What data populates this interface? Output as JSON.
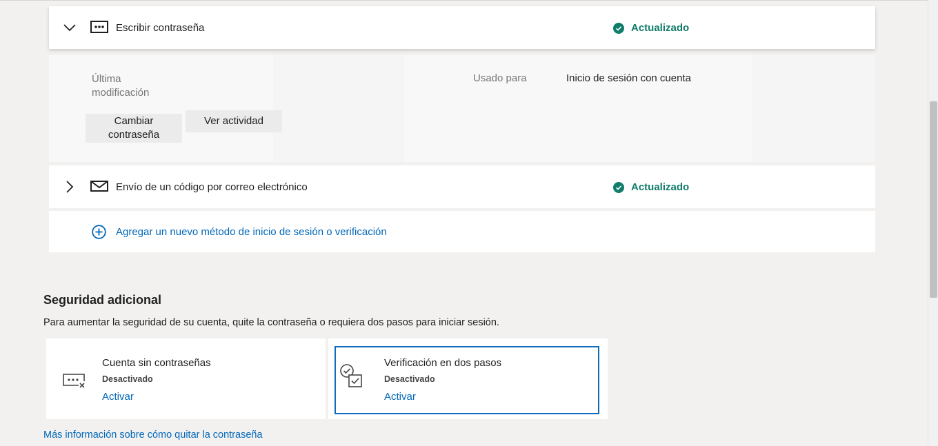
{
  "colors": {
    "accent_link": "#0067b8",
    "status_green": "#107c6a",
    "focus_border": "#0f6cbd",
    "background": "#f2f1f0"
  },
  "methods": [
    {
      "title": "Escribir contraseña",
      "status": "Actualizado",
      "expanded": true,
      "chevron_icon": "chevron-down-icon",
      "icon": "password-dots-icon"
    },
    {
      "title": "Envío de un código por correo electrónico",
      "status": "Actualizado",
      "expanded": false,
      "chevron_icon": "chevron-right-icon",
      "icon": "envelope-icon"
    }
  ],
  "password_details": {
    "last_modified_label": "Última modificación",
    "used_for_label": "Usado para",
    "used_for_value": "Inicio de sesión con cuenta",
    "change_button": "Cambiar contraseña",
    "activity_button": "Ver actividad"
  },
  "add_method": {
    "icon": "add-circle-icon",
    "label": "Agregar un nuevo método de inicio de sesión o verificación"
  },
  "additional_security": {
    "title": "Seguridad adicional",
    "description": "Para aumentar la seguridad de su cuenta, quite la contraseña o requiera dos pasos para iniciar sesión.",
    "options": [
      {
        "title": "Cuenta sin contraseñas",
        "status": "Desactivado",
        "action": "Activar",
        "icon": "passwordless-icon"
      },
      {
        "title": "Verificación en dos pasos",
        "status": "Desactivado",
        "action": "Activar",
        "icon": "two-step-verification-icon"
      }
    ],
    "more_info_link": "Más información sobre cómo quitar la contraseña"
  }
}
